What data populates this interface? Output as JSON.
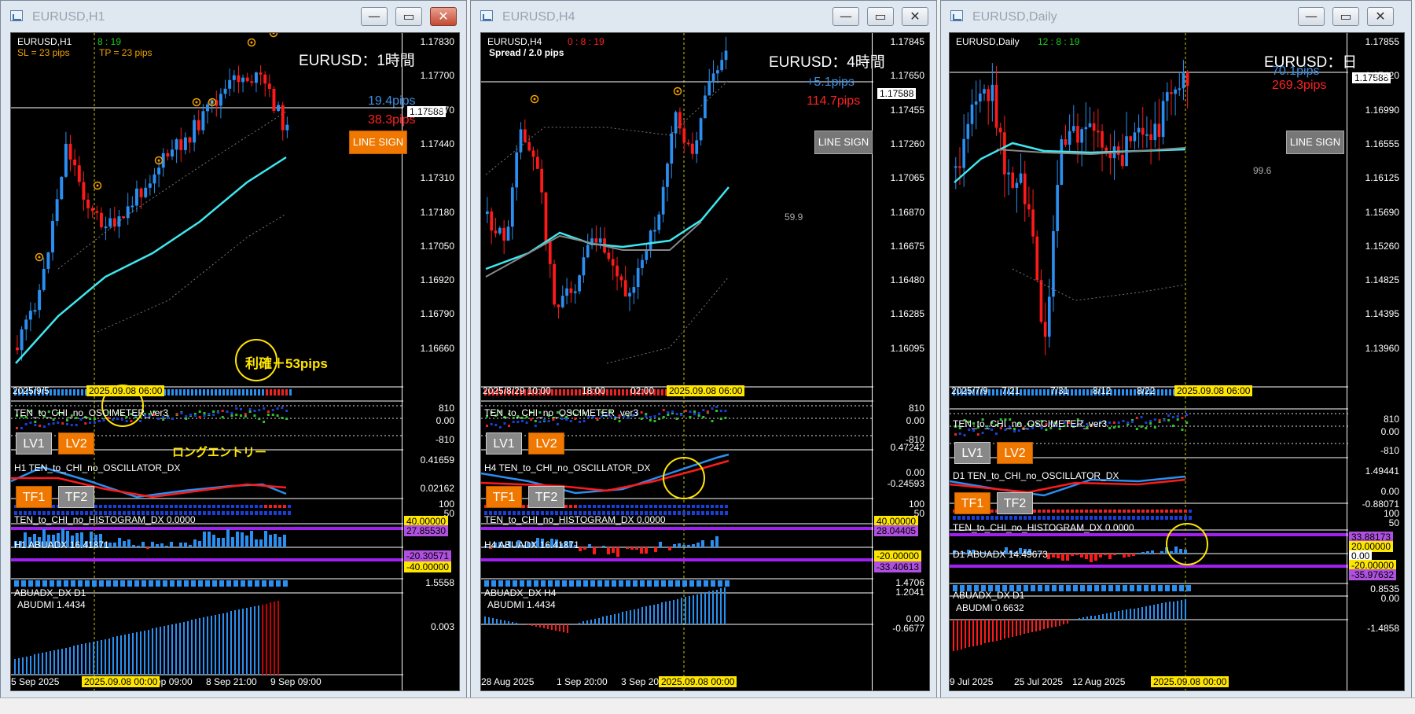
{
  "windows": [
    {
      "title": "EURUSD,H1",
      "chart": {
        "symbol": "EURUSD,H1",
        "timer": "8 : 19",
        "sl": "SL = 23 pips",
        "tp": "TP = 23 pips",
        "heading": "EURUSD：1時間",
        "pips_blue": "19.4pips",
        "pips_red": "38.3pips",
        "line_sign": "LINE SIGN",
        "price_box": "1.17588",
        "y_ticks": [
          "1.17830",
          "1.17700",
          "1.17570",
          "1.17440",
          "1.17310",
          "1.17180",
          "1.17050",
          "1.16920",
          "1.16790",
          "1.16660"
        ],
        "date_left": "2025/9/5",
        "date_badge": "2025.09.08 06:00",
        "annotation_profit": "利確＋53pips",
        "annotation_entry": "ロングエントリー"
      },
      "panels": {
        "osc_name": "TEN_to_CHI_no_OSCIMETER_ver3",
        "osc_ticks": [
          "810",
          "0.00",
          "-810"
        ],
        "lv1": "LV1",
        "lv2": "LV2",
        "oscillator_name": "H1 TEN_to_CHI_no_OSCILLATOR_DX",
        "oscillator_ticks": [
          "0.41659",
          "0.02162"
        ],
        "tf1": "TF1",
        "tf2": "TF2",
        "histogram_name": "TEN_to_CHI_no_HISTOGRAM_DX 0.0000",
        "histogram_ticks": [
          "100",
          "50"
        ],
        "abuadx_name": "H1 ABUADX 16.41871",
        "abuadx_badges": [
          "40.00000",
          "27.85530",
          "-20.30571",
          "-40.00000"
        ],
        "abuadx_dx_name": "ABUADX_DX D1",
        "abudmi_name": "ABUDMI 1.4434",
        "abudmi_ticks": [
          "1.5558",
          "0.003"
        ]
      },
      "x_axis": {
        "labels": [
          "5 Sep 2025",
          "8 Sep 09:00",
          "8 Sep 21:00",
          "9 Sep 09:00"
        ],
        "badge": "2025.09.08 00:00"
      }
    },
    {
      "title": "EURUSD,H4",
      "chart": {
        "symbol": "EURUSD,H4",
        "timer": "0 : 8 : 19",
        "spread": "Spread / 2.0 pips",
        "heading": "EURUSD：4時間",
        "pips_blue": "+5.1pips",
        "pips_red": "114.7pips",
        "line_sign": "LINE SIGN",
        "price_box": "1.17588",
        "y_ticks": [
          "1.17845",
          "1.17650",
          "1.17455",
          "1.17260",
          "1.17065",
          "1.16870",
          "1.16675",
          "1.16480",
          "1.16285",
          "1.16095"
        ],
        "ma_value": "59.9",
        "date_left": "2025/8/29 10:00",
        "time1": "18:00",
        "time2": "02:00",
        "date_badge": "2025.09.08 06:00"
      },
      "panels": {
        "osc_name": "TEN_to_CHI_no_OSCIMETER_ver3",
        "osc_ticks": [
          "810",
          "0.00",
          "-810"
        ],
        "lv1": "LV1",
        "lv2": "LV2",
        "oscillator_name": "H4 TEN_to_CHI_no_OSCILLATOR_DX",
        "oscillator_ticks": [
          "0.47242",
          "0.00",
          "-0.24593"
        ],
        "tf1": "TF1",
        "tf2": "TF2",
        "histogram_name": "TEN_to_CHI_no_HISTOGRAM_DX 0.0000",
        "histogram_ticks": [
          "100",
          "50"
        ],
        "abuadx_name": "H4 ABUADX 16.41871",
        "abuadx_badges": [
          "40.00000",
          "28.04405",
          "-20.00000",
          "-33.40613"
        ],
        "abuadx_dx_name": "ABUADX_DX H4",
        "abudmi_name": "ABUDMI 1.4434",
        "abudmi_ticks": [
          "1.4706",
          "1.2041",
          "0.00",
          "-0.6677"
        ]
      },
      "x_axis": {
        "labels": [
          "28 Aug 2025",
          "1 Sep 20:00",
          "3 Sep 20"
        ],
        "badge": "2025.09.08 00:00"
      }
    },
    {
      "title": "EURUSD,Daily",
      "chart": {
        "symbol": "EURUSD,Daily",
        "timer": "12 : 8 : 19",
        "heading": "EURUSD：日",
        "pips_blue": "70.1pips",
        "pips_red": "269.3pips",
        "line_sign": "LINE SIGN",
        "price_box": "1.17588",
        "y_ticks": [
          "1.17855",
          "1.17420",
          "1.16990",
          "1.16555",
          "1.16125",
          "1.15690",
          "1.15260",
          "1.14825",
          "1.14395",
          "1.13960"
        ],
        "ma_value": "99.6",
        "date_left": "2025/7/9",
        "dates": [
          "7/21",
          "7/31",
          "8/12",
          "8/22"
        ],
        "date_badge": "2025.09.08 06:00"
      },
      "panels": {
        "osc_name": "TEN_to_CHI_no_OSCIMETER_ver3",
        "osc_ticks": [
          "810",
          "0.00",
          "-810"
        ],
        "lv1": "LV1",
        "lv2": "LV2",
        "oscillator_name": "D1 TEN_to_CHI_no_OSCILLATOR_DX",
        "oscillator_ticks": [
          "1.49441",
          "0.00",
          "-0.88071"
        ],
        "tf1": "TF1",
        "tf2": "TF2",
        "histogram_name": "TEN_to_CHI_no_HISTOGRAM_DX 0.0000",
        "histogram_ticks": [
          "100",
          "50"
        ],
        "abuadx_name": "D1 ABUADX 14.49673",
        "abuadx_badges": [
          "33.88173",
          "20.00000",
          "0.00",
          "-20.00000",
          "-35.97632"
        ],
        "abuadx_dx_name": "ABUADX_DX D1",
        "abudmi_name": "ABUDMI 0.6632",
        "abudmi_ticks": [
          "0.8535",
          "0.00",
          "-1.4858"
        ]
      },
      "x_axis": {
        "labels": [
          "9 Jul 2025",
          "25 Jul 2025",
          "12 Aug 2025"
        ],
        "badge": "2025.09.08 00:00"
      }
    }
  ],
  "colors": {
    "bull": "#2a8ff0",
    "bear": "#ff1a1a",
    "ma": "#3ee8f0",
    "badge": "#ffe600",
    "lineSignOrange": "#f07800"
  },
  "icons": {
    "window_minimize": "minimize-icon",
    "window_maximize": "maximize-icon",
    "window_close": "close-icon"
  }
}
